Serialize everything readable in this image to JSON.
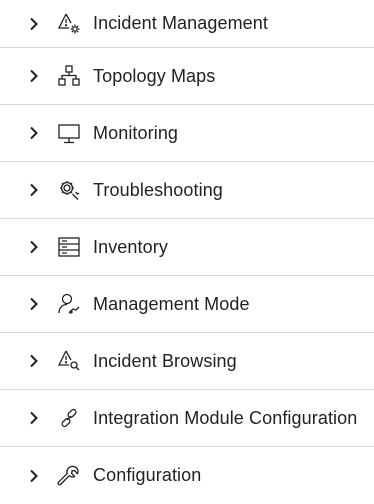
{
  "nav": {
    "items": [
      {
        "label": "Incident Management",
        "icon": "incident-management-icon"
      },
      {
        "label": "Topology Maps",
        "icon": "topology-maps-icon"
      },
      {
        "label": "Monitoring",
        "icon": "monitor-icon"
      },
      {
        "label": "Troubleshooting",
        "icon": "troubleshooting-icon"
      },
      {
        "label": "Inventory",
        "icon": "inventory-icon"
      },
      {
        "label": "Management Mode",
        "icon": "management-mode-icon"
      },
      {
        "label": "Incident Browsing",
        "icon": "incident-browsing-icon"
      },
      {
        "label": "Integration Module Configuration",
        "icon": "integration-link-icon"
      },
      {
        "label": "Configuration",
        "icon": "wrench-icon"
      }
    ]
  },
  "colors": {
    "text": "#222222",
    "divider": "#d9d9d9",
    "background": "#ffffff"
  }
}
